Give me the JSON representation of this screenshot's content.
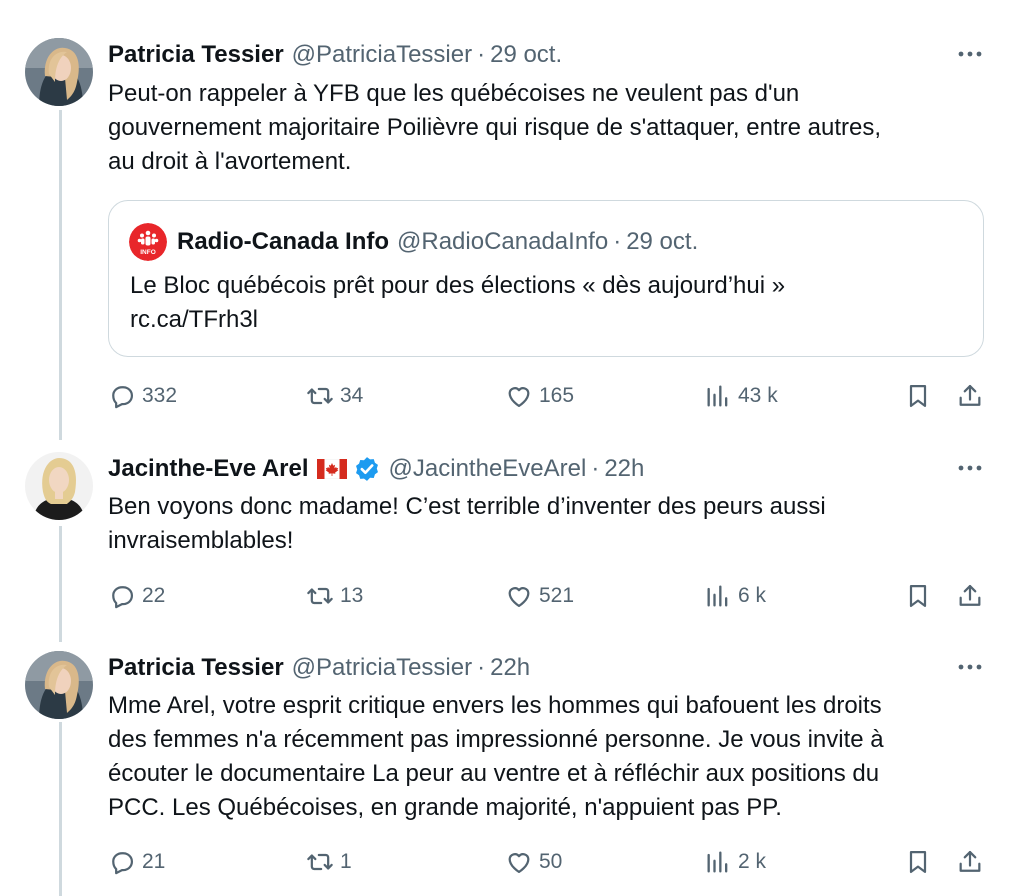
{
  "tweets": [
    {
      "name": "Patricia Tessier",
      "handle": "@PatriciaTessier",
      "separator": "·",
      "time": "29 oct.",
      "text": [
        "Peut-on rappeler à YFB que les québécoises ne veulent pas d'un",
        "gouvernement majoritaire Poilièvre qui risque de s'attaquer, entre autres,",
        "au droit à l'avortement."
      ],
      "quote": {
        "name": "Radio-Canada Info",
        "handle": "@RadioCanadaInfo",
        "separator": "·",
        "time": "29 oct.",
        "avatar_label": "INFO",
        "text": [
          "Le Bloc québécois prêt pour des élections « dès aujourd’hui »",
          "rc.ca/TFrh3l"
        ]
      },
      "stats": {
        "replies": "332",
        "reposts": "34",
        "likes": "165",
        "views": "43 k"
      }
    },
    {
      "name": "Jacinthe-Eve Arel",
      "handle": "@JacintheEveArel",
      "separator": "·",
      "time": "22h",
      "text": [
        "Ben voyons donc madame!  C’est terrible d’inventer des peurs aussi",
        "invraisemblables!"
      ],
      "stats": {
        "replies": "22",
        "reposts": "13",
        "likes": "521",
        "views": "6 k"
      }
    },
    {
      "name": "Patricia Tessier",
      "handle": "@PatriciaTessier",
      "separator": "·",
      "time": "22h",
      "text": [
        "Mme Arel, votre esprit critique envers les hommes qui bafouent les droits",
        "des femmes n'a récemment pas impressionné personne. Je vous invite à",
        "écouter le documentaire La peur au ventre et à réfléchir aux positions du",
        "PCC. Les Québécoises, en grande majorité, n'appuient pas PP."
      ],
      "stats": {
        "replies": "21",
        "reposts": "1",
        "likes": "50",
        "views": "2 k"
      }
    }
  ],
  "colors": {
    "text": "#0f1419",
    "secondary": "#536471",
    "border": "#cfd9de",
    "verified": "#1d9bf0",
    "radio_canada_red": "#e8262a"
  },
  "icons": [
    "more-icon",
    "reply-icon",
    "repost-icon",
    "like-icon",
    "views-icon",
    "bookmark-icon",
    "share-icon",
    "canada-flag-icon",
    "verified-badge-icon"
  ]
}
